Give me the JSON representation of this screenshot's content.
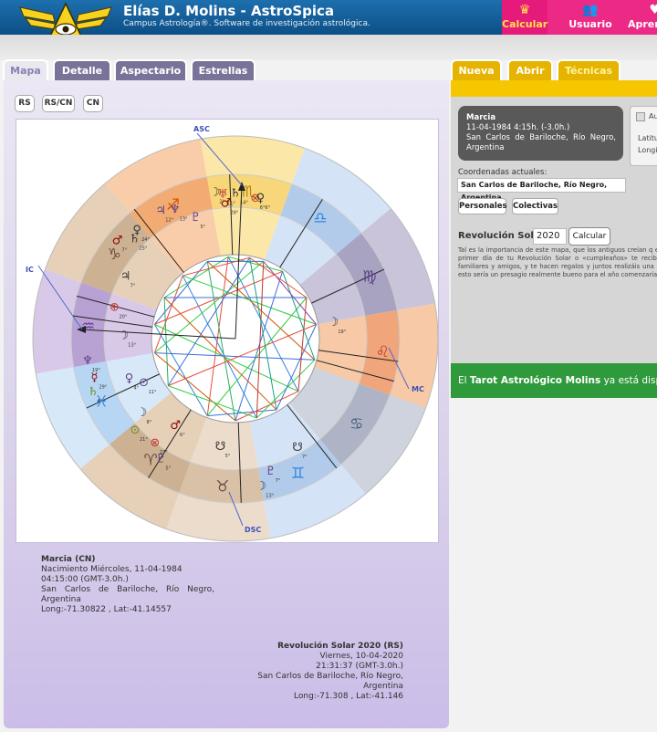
{
  "header": {
    "title": "Elías D. Molins - AstroSpica",
    "subtitle": "Campus Astrología®. Software de investigación astrológica.",
    "nav": [
      {
        "icon": "crown-icon",
        "label": "Calcular"
      },
      {
        "icon": "users-icon",
        "label": "Usuario"
      },
      {
        "icon": "heart-icon",
        "label": "Apren"
      }
    ]
  },
  "tabs_left": [
    "Mapa",
    "Detalle",
    "Aspectario",
    "Estrellas"
  ],
  "tabs_right": [
    "Nueva",
    "Abrir",
    "Técnicas"
  ],
  "chart_mode_buttons": [
    "RS",
    "RS/CN",
    "CN"
  ],
  "wheel": {
    "asc": "ASC",
    "ic": "IC",
    "mc": "MC",
    "dsc": "DSC",
    "planet_labels": [
      "2°",
      "11°",
      "28°",
      "14°",
      "6°",
      "6°",
      "12°",
      "13°",
      "5°",
      "25°",
      "24°",
      "7°",
      "7°",
      "20°",
      "13°",
      "19°",
      "4°",
      "11°",
      "6°",
      "5°",
      "7°",
      "29°",
      "6°",
      "8°",
      "21°",
      "27°",
      "5°",
      "7°",
      "19°",
      "13°"
    ]
  },
  "natal": {
    "name": "Marcia (CN)",
    "line1": "Nacimiento Miércoles, 11-04-1984",
    "line2": "04:15:00 (GMT-3.0h.)",
    "line3": "San Carlos de Bariloche, Río Negro, Argentina",
    "coords": "Long:-71.30822 , Lat:-41.14557"
  },
  "solar_return": {
    "title": "Revolución Solar 2020 (RS)",
    "line1": "Viernes, 10-04-2020",
    "line2": "21:31:37 (GMT-3.0h.)",
    "line3": "San Carlos de Bariloche, Río Negro, Argentina",
    "coords": "Long:-71.308 , Lat:-41.146"
  },
  "data_card": {
    "name": "Marcia",
    "datetime": "11-04-1984 4:15h. (-3.0h.)",
    "place": "San Carlos de Bariloche, Río Negro, Argentina"
  },
  "options_card": {
    "label1": "Au",
    "label2": "Latitu",
    "label3": "Longi"
  },
  "coords_label": "Coordenadas actuales:",
  "coords_value": "San Carlos de Bariloche, Río Negro, Argentina",
  "aspect_buttons": [
    "Personales",
    "Colectivas"
  ],
  "rs_label": "Revolución Solar",
  "rs_year": "2020",
  "calc_button": "Calcular",
  "rs_description": "Tal es la importancia de este mapa, que los antiguos creían q el primer día de tu Revolución Solar o «cumpleaños» te recibe familiares y amigos, y te hacen regalos y juntos realizáis una fi esto sería un presagio realmente bueno para el año comenzaría.",
  "tarot_banner": {
    "pre": "El ",
    "bold": "Tarot Astrológico Molins",
    "post": " ya está dispon"
  }
}
